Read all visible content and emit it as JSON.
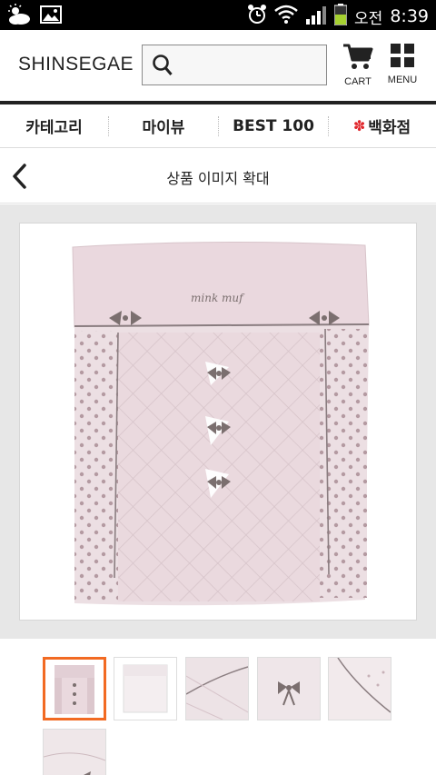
{
  "status_bar": {
    "ampm": "오전",
    "time": "8:39",
    "icons": [
      "weather-icon",
      "image-icon",
      "alarm-icon",
      "wifi-icon",
      "signal-icon",
      "battery-icon"
    ]
  },
  "header": {
    "logo": "SHINSEGAE",
    "search": {
      "value": "",
      "placeholder": ""
    },
    "cart_label": "CART",
    "menu_label": "MENU"
  },
  "category_nav": {
    "items": [
      {
        "label": "카테고리"
      },
      {
        "label": "마이뷰"
      },
      {
        "label": "BEST 100"
      },
      {
        "label": "백화점"
      }
    ]
  },
  "title_bar": {
    "title": "상품 이미지 확대"
  },
  "viewer": {
    "product_embroidery": "mink muf",
    "colors": {
      "blanket": "#e8d8dd",
      "ribbon": "#7b6f6f",
      "border": "#f26a22"
    }
  },
  "thumbnails": {
    "count": 6,
    "active_index": 0,
    "items": [
      "thumbnail-full-view",
      "thumbnail-back-view",
      "thumbnail-corner-detail",
      "thumbnail-ribbon-detail",
      "thumbnail-edge-detail",
      "thumbnail-embroidery-detail"
    ]
  }
}
